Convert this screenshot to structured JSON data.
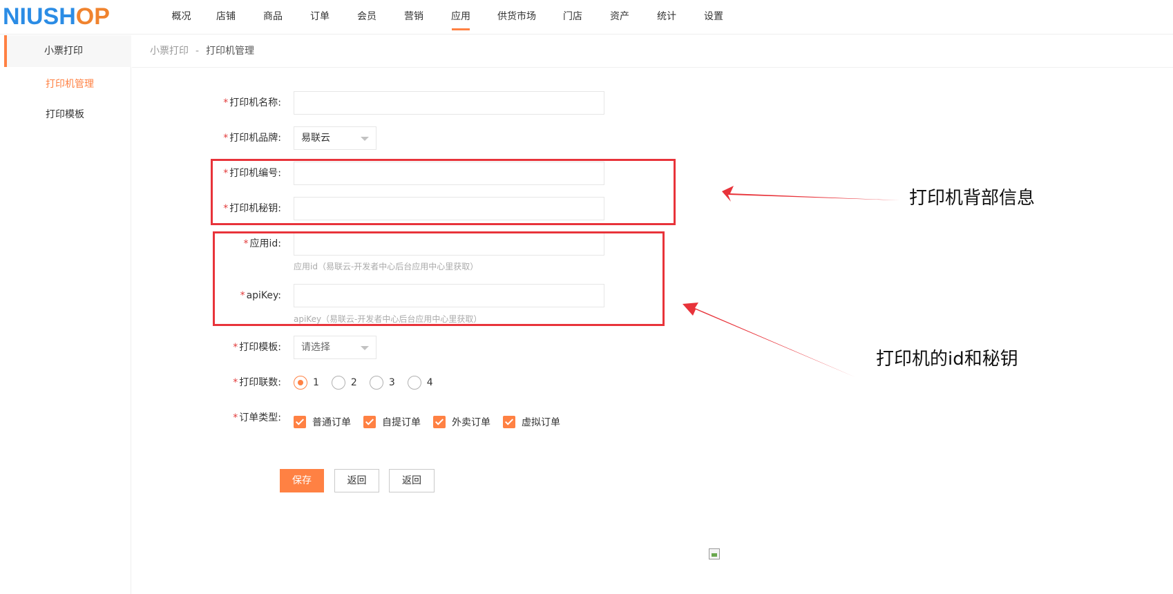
{
  "header": {
    "logo": {
      "part1": "NIUSH",
      "part2": "O",
      "part3": "P"
    },
    "nav": [
      {
        "label": "概况",
        "active": false
      },
      {
        "label": "店铺",
        "active": false
      },
      {
        "label": "商品",
        "active": false
      },
      {
        "label": "订单",
        "active": false
      },
      {
        "label": "会员",
        "active": false
      },
      {
        "label": "营销",
        "active": false
      },
      {
        "label": "应用",
        "active": true
      },
      {
        "label": "供货市场",
        "active": false
      },
      {
        "label": "门店",
        "active": false
      },
      {
        "label": "资产",
        "active": false
      },
      {
        "label": "统计",
        "active": false
      },
      {
        "label": "设置",
        "active": false
      }
    ],
    "accent_color": "#ff8143"
  },
  "sidebar": {
    "title": "小票打印",
    "items": [
      {
        "label": "打印机管理",
        "active": true
      },
      {
        "label": "打印模板",
        "active": false
      }
    ]
  },
  "breadcrumb": {
    "parent": "小票打印",
    "separator": "-",
    "current": "打印机管理"
  },
  "form": {
    "required_mark": "*",
    "printer_name": {
      "label": "打印机名称:",
      "value": ""
    },
    "printer_brand": {
      "label": "打印机品牌:",
      "value": "易联云"
    },
    "printer_number": {
      "label": "打印机编号:",
      "value": ""
    },
    "printer_secret": {
      "label": "打印机秘钥:",
      "value": ""
    },
    "app_id": {
      "label": "应用id:",
      "value": "",
      "hint": "应用id（易联云-开发者中心后台应用中心里获取）"
    },
    "api_key": {
      "label": "apiKey:",
      "value": "",
      "hint": "apiKey（易联云-开发者中心后台应用中心里获取）"
    },
    "print_template": {
      "label": "打印模板:",
      "value": "请选择"
    },
    "print_copies": {
      "label": "打印联数:",
      "options": [
        {
          "label": "1",
          "checked": true
        },
        {
          "label": "2",
          "checked": false
        },
        {
          "label": "3",
          "checked": false
        },
        {
          "label": "4",
          "checked": false
        }
      ]
    },
    "order_type": {
      "label": "订单类型:",
      "options": [
        {
          "label": "普通订单",
          "checked": true
        },
        {
          "label": "自提订单",
          "checked": true
        },
        {
          "label": "外卖订单",
          "checked": true
        },
        {
          "label": "虚拟订单",
          "checked": true
        }
      ]
    },
    "buttons": {
      "save": "保存",
      "back1": "返回",
      "back2": "返回"
    }
  },
  "annotations": {
    "printer_back_info": "打印机背部信息",
    "printer_id_secret": "打印机的id和秘钥",
    "color": "#e8333a"
  }
}
